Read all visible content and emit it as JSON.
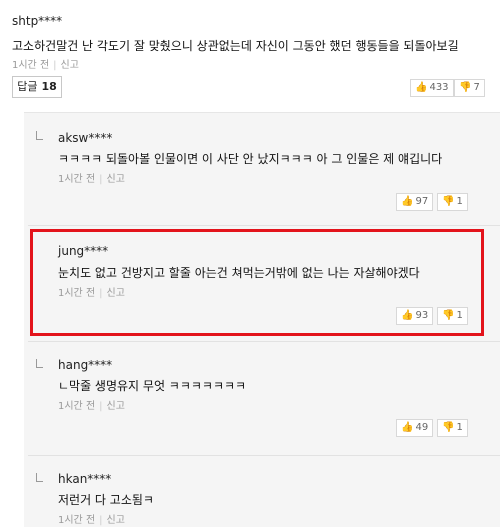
{
  "top_comment": {
    "username": "shtp****",
    "text": "고소하건말건 난 각도기 잘 맞췄으니 상관없는데 자신이 그동안 했던 행동들을 되돌아보길",
    "time": "1시간 전",
    "report": "신고",
    "reply_label": "답글",
    "reply_count": "18",
    "likes": "433",
    "dislikes": "7"
  },
  "replies": [
    {
      "username": "aksw****",
      "text": "ㅋㅋㅋㅋ 되돌아볼 인물이면 이 사단 안 났지ㅋㅋㅋ 아 그 인물은 제 얘깁니다",
      "time": "1시간 전",
      "report": "신고",
      "likes": "97",
      "dislikes": "1"
    },
    {
      "username": "jung****",
      "text": "눈치도 없고 건방지고 할줄 아는건 쳐먹는거밖에 없는 나는 자살해야겠다",
      "time": "1시간 전",
      "report": "신고",
      "likes": "93",
      "dislikes": "1"
    },
    {
      "username": "hang****",
      "text": "ㄴ막줄 생명유지 무엇 ㅋㅋㅋㅋㅋㅋㅋ",
      "time": "1시간 전",
      "report": "신고",
      "likes": "49",
      "dislikes": "1"
    },
    {
      "username": "hkan****",
      "text": "저런거 다 고소됨ㅋ",
      "time": "1시간 전",
      "report": "신고"
    }
  ],
  "icons": {
    "like": "thumbs-up-icon",
    "dislike": "thumbs-down-icon"
  },
  "colors": {
    "highlight": "#e3131b",
    "reply_bg": "#f5f5f5"
  }
}
